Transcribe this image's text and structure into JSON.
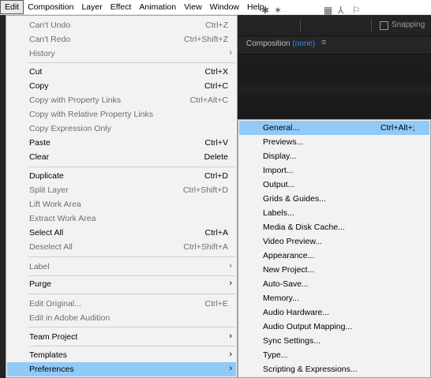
{
  "menubar": {
    "items": [
      "Edit",
      "Composition",
      "Layer",
      "Effect",
      "Animation",
      "View",
      "Window",
      "Help"
    ]
  },
  "toolbar": {
    "snapping_label": "Snapping"
  },
  "composition_panel": {
    "title": "Composition",
    "value": "(none)",
    "menu_icon": "≡"
  },
  "edit_menu": {
    "items": [
      {
        "label": "Can't Undo",
        "shortcut": "Ctrl+Z",
        "enabled": false
      },
      {
        "label": "Can't Redo",
        "shortcut": "Ctrl+Shift+Z",
        "enabled": false
      },
      {
        "label": "History",
        "submenu": true,
        "enabled": false
      },
      {
        "label": "Cut",
        "shortcut": "Ctrl+X",
        "enabled": true
      },
      {
        "label": "Copy",
        "shortcut": "Ctrl+C",
        "enabled": true
      },
      {
        "label": "Copy with Property Links",
        "shortcut": "Ctrl+Alt+C",
        "enabled": false
      },
      {
        "label": "Copy with Relative Property Links",
        "enabled": false
      },
      {
        "label": "Copy Expression Only",
        "enabled": false
      },
      {
        "label": "Paste",
        "shortcut": "Ctrl+V",
        "enabled": true
      },
      {
        "label": "Clear",
        "shortcut": "Delete",
        "enabled": true
      },
      {
        "label": "Duplicate",
        "shortcut": "Ctrl+D",
        "enabled": true
      },
      {
        "label": "Split Layer",
        "shortcut": "Ctrl+Shift+D",
        "enabled": false
      },
      {
        "label": "Lift Work Area",
        "enabled": false
      },
      {
        "label": "Extract Work Area",
        "enabled": false
      },
      {
        "label": "Select All",
        "shortcut": "Ctrl+A",
        "enabled": true
      },
      {
        "label": "Deselect All",
        "shortcut": "Ctrl+Shift+A",
        "enabled": false
      },
      {
        "label": "Label",
        "submenu": true,
        "enabled": false
      },
      {
        "label": "Purge",
        "submenu": true,
        "enabled": true
      },
      {
        "label": "Edit Original...",
        "shortcut": "Ctrl+E",
        "enabled": false
      },
      {
        "label": "Edit in Adobe Audition",
        "enabled": false
      },
      {
        "label": "Team Project",
        "submenu": true,
        "enabled": true
      },
      {
        "label": "Templates",
        "submenu": true,
        "enabled": true
      },
      {
        "label": "Preferences",
        "submenu": true,
        "enabled": true,
        "highlighted": true
      }
    ]
  },
  "preferences_menu": {
    "items": [
      {
        "label": "General...",
        "shortcut": "Ctrl+Alt+;",
        "highlighted": true
      },
      {
        "label": "Previews..."
      },
      {
        "label": "Display..."
      },
      {
        "label": "Import..."
      },
      {
        "label": "Output..."
      },
      {
        "label": "Grids & Guides..."
      },
      {
        "label": "Labels..."
      },
      {
        "label": "Media & Disk Cache..."
      },
      {
        "label": "Video Preview..."
      },
      {
        "label": "Appearance..."
      },
      {
        "label": "New Project..."
      },
      {
        "label": "Auto-Save..."
      },
      {
        "label": "Memory..."
      },
      {
        "label": "Audio Hardware..."
      },
      {
        "label": "Audio Output Mapping..."
      },
      {
        "label": "Sync Settings..."
      },
      {
        "label": "Type..."
      },
      {
        "label": "Scripting & Expressions..."
      }
    ]
  },
  "icons": {
    "submenu_arrow": "›"
  },
  "colors": {
    "highlight": "#91c9f7",
    "disabled_text": "#6d6d6d",
    "menu_bg": "#f2f2f2",
    "accent_blue": "#2d8ceb"
  }
}
